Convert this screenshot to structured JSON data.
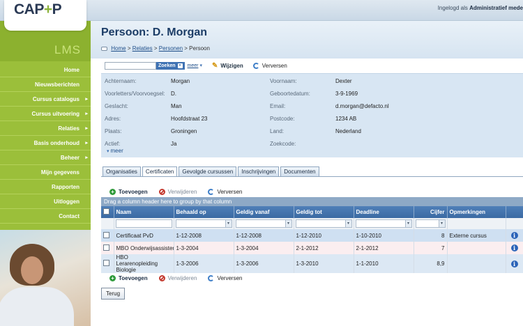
{
  "header": {
    "logo_main": "CAP",
    "logo_plus": "+",
    "logo_end": "P",
    "user_prefix": "Ingelogd als",
    "user_name": "Administratief mede"
  },
  "sidebar": {
    "brand": "LMS",
    "items": [
      {
        "label": "Home",
        "arrow": false
      },
      {
        "label": "Nieuwsberichten",
        "arrow": false
      },
      {
        "label": "Cursus catalogus",
        "arrow": true
      },
      {
        "label": "Cursus uitvoering",
        "arrow": true
      },
      {
        "label": "Relaties",
        "arrow": true
      },
      {
        "label": "Basis onderhoud",
        "arrow": true
      },
      {
        "label": "Beheer",
        "arrow": true
      },
      {
        "label": "Mijn gegevens",
        "arrow": false
      },
      {
        "label": "Rapporten",
        "arrow": false
      },
      {
        "label": "Uitloggen",
        "arrow": false
      },
      {
        "label": "Contact",
        "arrow": false
      }
    ]
  },
  "page": {
    "title": "Persoon: D. Morgan",
    "breadcrumb": [
      "Home",
      "Relaties",
      "Personen",
      "Persoon"
    ],
    "sep": ">"
  },
  "toolbar": {
    "search_placeholder": "",
    "search_label": "Zoeken",
    "meer": "meer",
    "edit_label": "Wijzigen",
    "refresh_label": "Verversen"
  },
  "details": {
    "left": [
      {
        "label": "Achternaam:",
        "value": "Morgan"
      },
      {
        "label": "Voorletters/Voorvoegsel:",
        "value": "D."
      },
      {
        "label": "Geslacht:",
        "value": "Man"
      },
      {
        "label": "Adres:",
        "value": "Hoofdstraat 23"
      },
      {
        "label": "Plaats:",
        "value": "Groningen"
      },
      {
        "label": "Actief:",
        "value": "Ja"
      }
    ],
    "right": [
      {
        "label": "Voornaam:",
        "value": "Dexter"
      },
      {
        "label": "Geboortedatum:",
        "value": "3-9-1969"
      },
      {
        "label": "Email:",
        "value": "d.morgan@defacto.nl"
      },
      {
        "label": "Postcode:",
        "value": "1234 AB"
      },
      {
        "label": "Land:",
        "value": "Nederland"
      },
      {
        "label": "Zoekcode:",
        "value": ""
      }
    ],
    "more": "meer"
  },
  "tabs": [
    "Organisaties",
    "Certificaten",
    "Gevolgde cursussen",
    "Inschrijvingen",
    "Documenten"
  ],
  "active_tab": 1,
  "gridbar": {
    "add": "Toevoegen",
    "delete": "Verwijderen",
    "refresh": "Verversen"
  },
  "grid": {
    "group_hint": "Drag a column header here to group by that column",
    "columns": [
      "Naam",
      "Behaald op",
      "Geldig vanaf",
      "Geldig tot",
      "Deadline",
      "Cijfer",
      "Opmerkingen"
    ],
    "rows": [
      {
        "naam": "Certificaat PvD",
        "behaald": "1-12-2008",
        "vanaf": "1-12-2008",
        "tot": "1-12-2010",
        "deadline": "1-10-2010",
        "cijfer": "8",
        "opm": "Externe cursus"
      },
      {
        "naam": "MBO Onderwijsassistent",
        "behaald": "1-3-2004",
        "vanaf": "1-3-2004",
        "tot": "2-1-2012",
        "deadline": "2-1-2012",
        "cijfer": "7",
        "opm": ""
      },
      {
        "naam": "HBO Lerarenopleiding Biologie",
        "behaald": "1-3-2006",
        "vanaf": "1-3-2006",
        "tot": "1-3-2010",
        "deadline": "1-1-2010",
        "cijfer": "8,9",
        "opm": ""
      }
    ]
  },
  "back_label": "Terug",
  "colors": {
    "sidebar": "#9bbf3a",
    "title": "#1b3c66",
    "grid_header": "#3b6aa3"
  }
}
